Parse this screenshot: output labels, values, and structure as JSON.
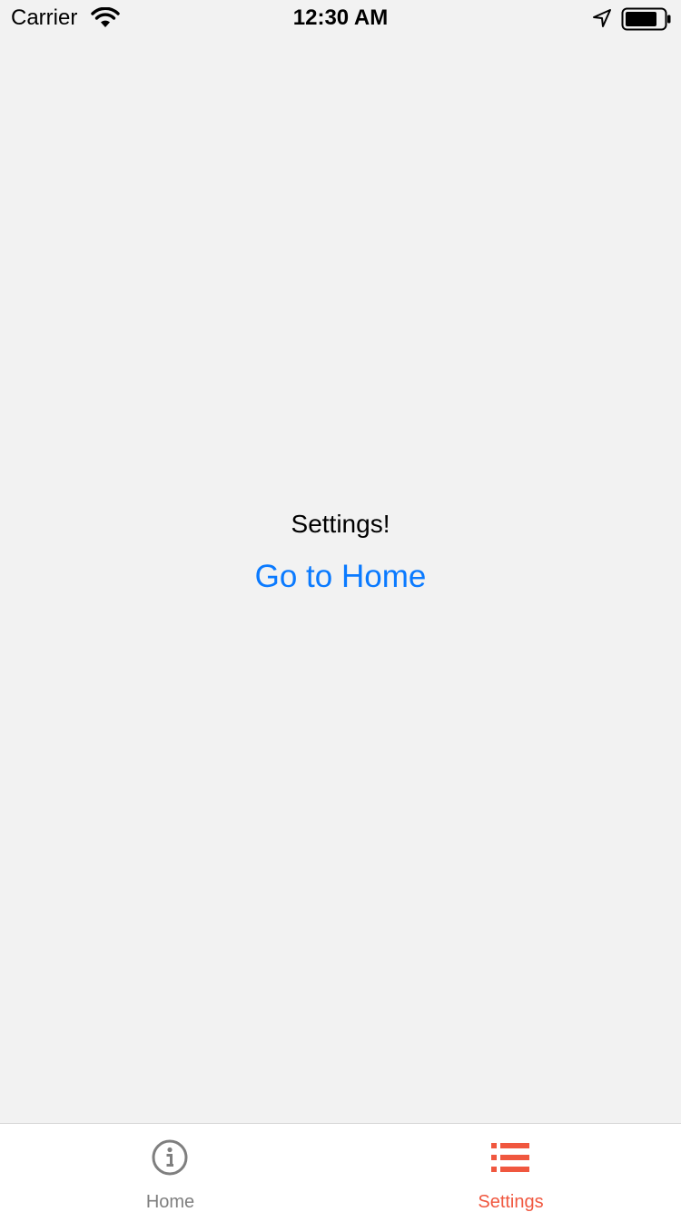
{
  "status_bar": {
    "carrier": "Carrier",
    "time": "12:30 AM"
  },
  "main": {
    "heading": "Settings!",
    "link_label": "Go to Home"
  },
  "tab_bar": {
    "tabs": [
      {
        "label": "Home",
        "icon": "info-circle-icon",
        "active": false,
        "color": "#7f7f7f"
      },
      {
        "label": "Settings",
        "icon": "list-icon",
        "active": true,
        "color": "#f0573f"
      }
    ]
  },
  "colors": {
    "background": "#f2f2f2",
    "link": "#0a7aff",
    "active_tab": "#f0573f",
    "inactive_tab": "#7f7f7f"
  }
}
